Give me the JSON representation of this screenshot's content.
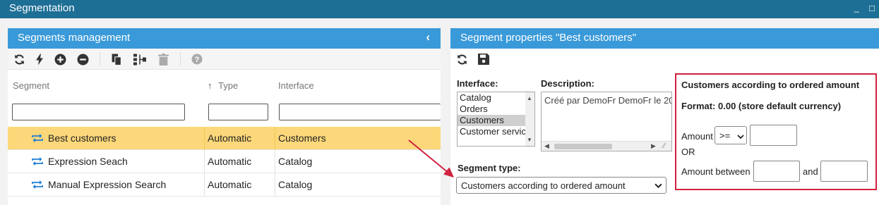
{
  "window": {
    "title": "Segmentation",
    "minimize_glyph": "_",
    "maximize_glyph": "□"
  },
  "segments_panel": {
    "title": "Segments management",
    "collapse_glyph": "‹",
    "toolbar_icons": [
      "refresh-icon",
      "lightning-icon",
      "add-icon",
      "remove-icon",
      "copy-icon",
      "tree-icon",
      "delete-icon",
      "help-icon"
    ],
    "columns": {
      "segment": "Segment",
      "type": "Type",
      "interface": "Interface"
    },
    "sort_glyph": "↑",
    "rows": [
      {
        "segment": "Best customers",
        "type": "Automatic",
        "interface": "Customers",
        "selected": true
      },
      {
        "segment": "Expression Seach",
        "type": "Automatic",
        "interface": "Catalog",
        "selected": false
      },
      {
        "segment": "Manual Expression Search",
        "type": "Automatic",
        "interface": "Catalog",
        "selected": false
      }
    ]
  },
  "properties_panel": {
    "title": "Segment properties \"Best customers\"",
    "toolbar_icons": [
      "refresh-icon",
      "save-icon"
    ],
    "interface_label": "Interface:",
    "interface_options": [
      "Catalog",
      "Orders",
      "Customers",
      "Customer servic"
    ],
    "interface_selected": "Customers",
    "description_label": "Description:",
    "description_value": "Créé par DemoFr DemoFr le 20",
    "segment_type_label": "Segment type:",
    "segment_type_value": "Customers according to ordered amount",
    "criteria": {
      "title": "Customers according to ordered amount",
      "format_text": "Format: 0.00 (store default currency)",
      "amount_label": "Amount",
      "operator_value": ">=",
      "or_label": "OR",
      "between_label": "Amount between",
      "and_label": "and"
    }
  },
  "colors": {
    "titlebar": "#1e6f95",
    "panel_header": "#3a9ad9",
    "selected_row": "#fcd87a",
    "highlight": "#d0213f",
    "row_icon": "#1f7fd6"
  }
}
